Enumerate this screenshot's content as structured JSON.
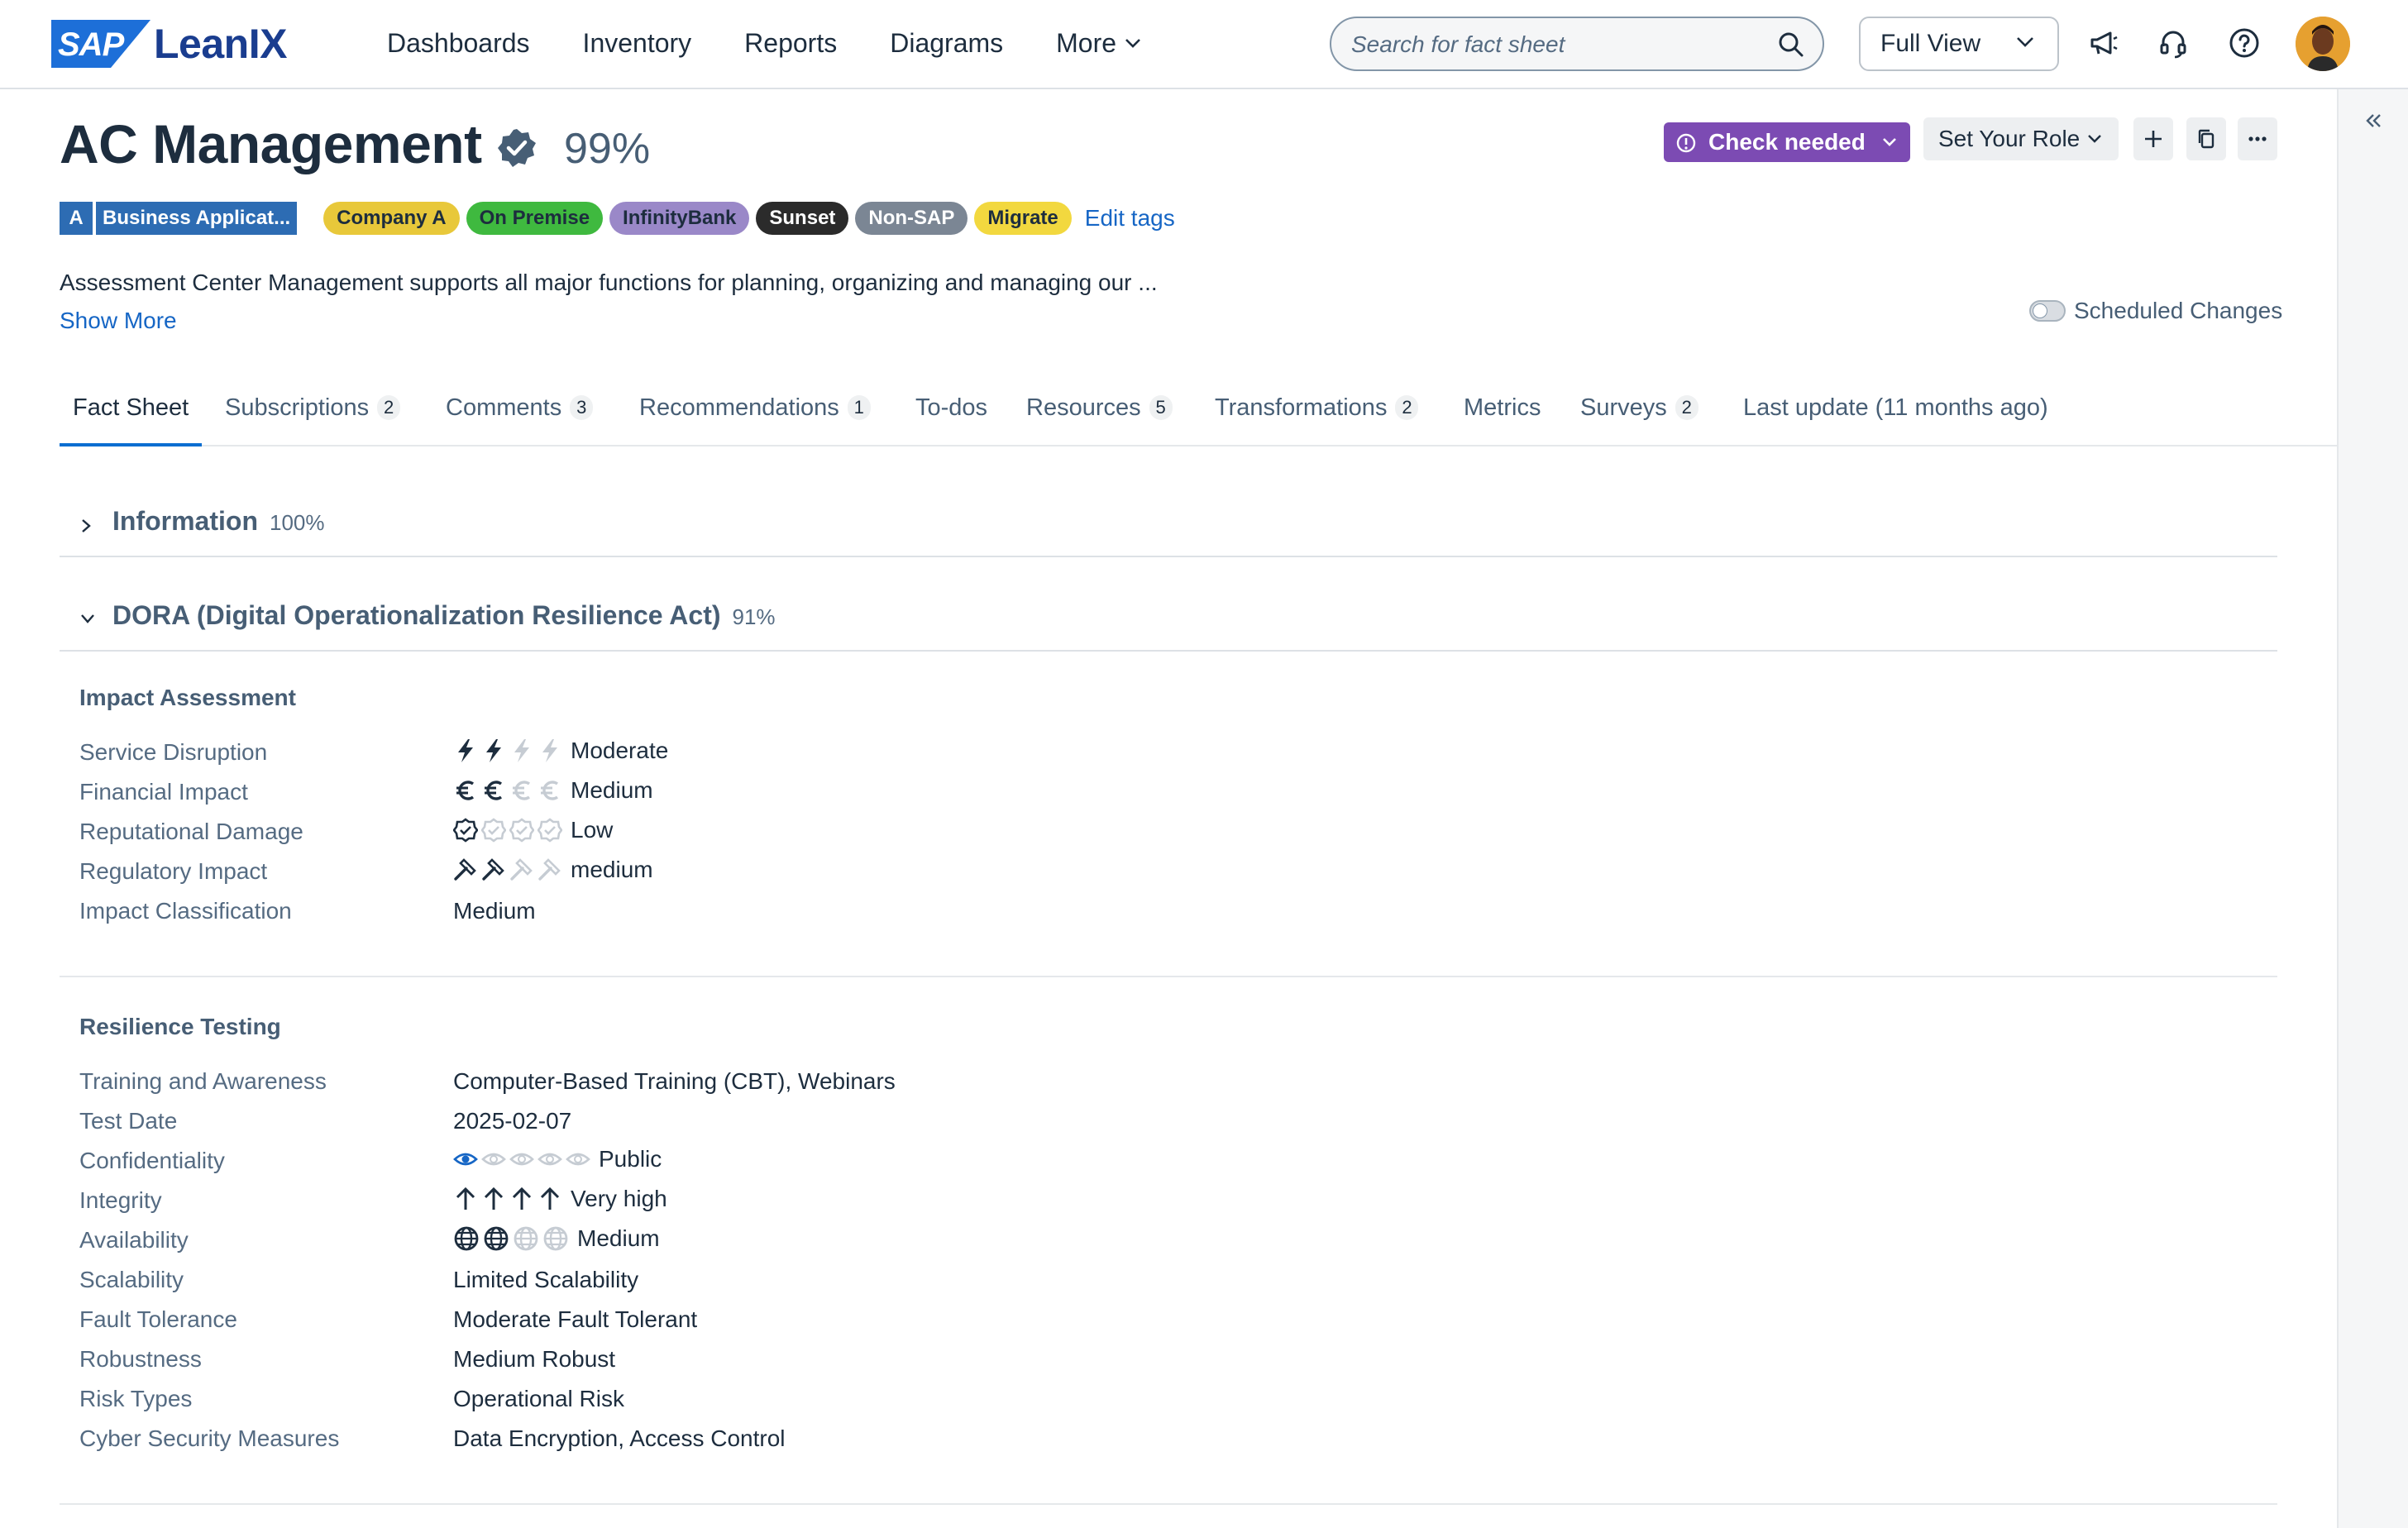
{
  "topbar": {
    "logo_badge": "SAP",
    "logo_text": "LeanIX",
    "nav": [
      "Dashboards",
      "Inventory",
      "Reports",
      "Diagrams",
      "More"
    ],
    "search_placeholder": "Search for fact sheet",
    "view_select": "Full View"
  },
  "header": {
    "title": "AC Management",
    "completion": "99%",
    "status_button": "Check needed",
    "role_button": "Set Your Role",
    "type_letter": "A",
    "type_name": "Business Applicat...",
    "tags": [
      {
        "label": "Company A",
        "bg": "#e8c83a",
        "fg": "#1d2d3e"
      },
      {
        "label": "On Premise",
        "bg": "#3fb93f",
        "fg": "#1d2d3e"
      },
      {
        "label": "InfinityBank",
        "bg": "#9a88c8",
        "fg": "#1d2d3e"
      },
      {
        "label": "Sunset",
        "bg": "#2b2b2b",
        "fg": "#ffffff"
      },
      {
        "label": "Non-SAP",
        "bg": "#7b8694",
        "fg": "#ffffff"
      },
      {
        "label": "Migrate",
        "bg": "#f2d83f",
        "fg": "#1d2d3e"
      }
    ],
    "edit_tags": "Edit tags",
    "description": "Assessment Center Management supports all major functions for planning, organizing and managing our ...",
    "show_more": "Show More",
    "scheduled_changes": "Scheduled Changes"
  },
  "tabs": [
    {
      "label": "Fact Sheet",
      "count": ""
    },
    {
      "label": "Subscriptions",
      "count": "2"
    },
    {
      "label": "Comments",
      "count": "3"
    },
    {
      "label": "Recommendations",
      "count": "1"
    },
    {
      "label": "To-dos",
      "count": ""
    },
    {
      "label": "Resources",
      "count": "5"
    },
    {
      "label": "Transformations",
      "count": "2"
    },
    {
      "label": "Metrics",
      "count": ""
    },
    {
      "label": "Surveys",
      "count": "2"
    },
    {
      "label": "Last update (11 months ago)",
      "count": ""
    }
  ],
  "sections": {
    "information": {
      "title": "Information",
      "percent": "100%"
    },
    "dora": {
      "title": "DORA (Digital Operationalization Resilience Act)",
      "percent": "91%"
    }
  },
  "impact": {
    "title": "Impact Assessment",
    "rows": [
      {
        "label": "Service Disruption",
        "value": "Moderate",
        "icon": "lightning-icon",
        "level": 2,
        "max": 4
      },
      {
        "label": "Financial Impact",
        "value": "Medium",
        "icon": "euro-icon",
        "level": 2,
        "max": 4
      },
      {
        "label": "Reputational Damage",
        "value": "Low",
        "icon": "badge-check-icon",
        "level": 1,
        "max": 4
      },
      {
        "label": "Regulatory Impact",
        "value": "medium",
        "icon": "gavel-icon",
        "level": 2,
        "max": 4
      },
      {
        "label": "Impact Classification",
        "value": "Medium"
      }
    ]
  },
  "resilience": {
    "title": "Resilience Testing",
    "rows": [
      {
        "label": "Training and Awareness",
        "value": "Computer-Based Training (CBT), Webinars"
      },
      {
        "label": "Test Date",
        "value": "2025-02-07"
      },
      {
        "label": "Confidentiality",
        "value": "Public",
        "icon": "eye-icon",
        "level": 1,
        "max": 5
      },
      {
        "label": "Integrity",
        "value": "Very high",
        "icon": "arrow-up-icon",
        "level": 4,
        "max": 4
      },
      {
        "label": "Availability",
        "value": "Medium",
        "icon": "globe-icon",
        "level": 2,
        "max": 4
      },
      {
        "label": "Scalability",
        "value": "Limited Scalability"
      },
      {
        "label": "Fault Tolerance",
        "value": "Moderate Fault Tolerant"
      },
      {
        "label": "Robustness",
        "value": "Medium Robust"
      },
      {
        "label": "Risk Types",
        "value": "Operational Risk"
      },
      {
        "label": "Cyber Security Measures",
        "value": "Data Encryption, Access Control"
      }
    ]
  }
}
